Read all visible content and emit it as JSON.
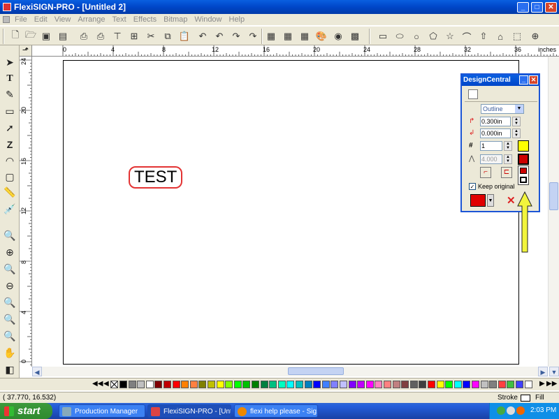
{
  "window": {
    "title": "FlexiSIGN-PRO - [Untitled 2]"
  },
  "menu": [
    "File",
    "Edit",
    "View",
    "Arrange",
    "Text",
    "Effects",
    "Bitmap",
    "Window",
    "Help"
  ],
  "toolbar_icons": [
    "new-icon",
    "open-icon",
    "save-icon",
    "print-icon",
    "print-preview-icon",
    "plot-icon",
    "cut-icon",
    "copy-icon",
    "paste-icon",
    "undo-icon",
    "undo-list-icon",
    "redo-icon",
    "redo-list-icon",
    "align-icon",
    "distribute-icon",
    "group-icon",
    "palette-icon",
    "color-picker-icon",
    "color-swatches-icon",
    "rectangle-icon",
    "ellipse-icon",
    "circle-icon",
    "polygon-icon",
    "star-icon",
    "arc-icon",
    "arrow-shape-icon",
    "house-shape-icon",
    "badge-shape-icon",
    "crosshair-icon"
  ],
  "ruler": {
    "units": "inches",
    "top_ticks": [
      "0",
      "4",
      "8",
      "12",
      "16",
      "20",
      "24",
      "28",
      "32",
      "36"
    ],
    "left_ticks": [
      "24",
      "20",
      "16",
      "12",
      "8",
      "4",
      "0"
    ]
  },
  "canvas": {
    "text": "TEST",
    "outline_color": "#e33333"
  },
  "design_central": {
    "title": "DesignCentral",
    "mode": "Outline",
    "offset": "0.300in",
    "inset": "0.000in",
    "count": "1",
    "limit": "4.000",
    "keep_original": "Keep original",
    "fill_color": "#e00000"
  },
  "palette_colors": [
    "#000000",
    "#808080",
    "#c0c0c0",
    "#ffffff",
    "#800000",
    "#c00000",
    "#ff0000",
    "#ff8000",
    "#ff8040",
    "#808000",
    "#c0c000",
    "#ffff00",
    "#80ff00",
    "#00ff00",
    "#00c000",
    "#008000",
    "#008040",
    "#00c080",
    "#00ffc0",
    "#00ffff",
    "#00c0c0",
    "#0080c0",
    "#0000ff",
    "#4080ff",
    "#8080ff",
    "#c0c0ff",
    "#8000ff",
    "#c000ff",
    "#ff00ff",
    "#ff80c0",
    "#ff8080",
    "#c08080",
    "#804040",
    "#606060",
    "#404040",
    "#ff0000",
    "#ffff00",
    "#00ff00",
    "#00ffff",
    "#0000ff",
    "#ff00ff",
    "#c0c0c0",
    "#808080",
    "#ff4040",
    "#40c040",
    "#4040ff",
    "#ffffff"
  ],
  "status": {
    "coords": "( 37.770,  16.532)",
    "stroke_label": "Stroke",
    "fill_label": "Fill"
  },
  "taskbar": {
    "start": "start",
    "tasks": [
      "Production Manager",
      "FlexiSIGN-PRO - [Unti...",
      "flexi help please - Sig..."
    ],
    "clock": "2:03 PM"
  }
}
